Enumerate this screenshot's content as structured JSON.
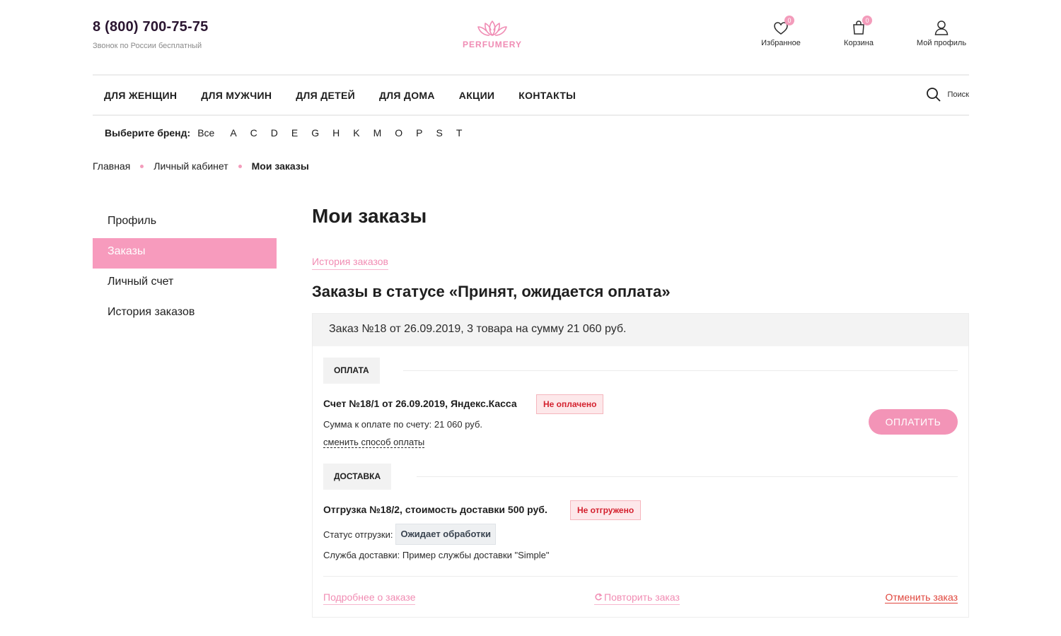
{
  "header": {
    "phone": "8 (800) 700-75-75",
    "phone_note": "Звонок по России бесплатный",
    "logo_text": "PERFUMERY",
    "favorites": {
      "label": "Избранное",
      "count": "0"
    },
    "cart": {
      "label": "Корзина",
      "count": "0"
    },
    "profile": {
      "label": "Мой профиль"
    }
  },
  "nav": {
    "items": [
      "ДЛЯ ЖЕНЩИН",
      "ДЛЯ МУЖЧИН",
      "ДЛЯ ДЕТЕЙ",
      "ДЛЯ ДОМА",
      "АКЦИИ",
      "КОНТАКТЫ"
    ],
    "search_label": "Поиск"
  },
  "brands": {
    "label": "Выберите бренд:",
    "letters": [
      "Все",
      "A",
      "C",
      "D",
      "E",
      "G",
      "H",
      "K",
      "M",
      "O",
      "P",
      "S",
      "T"
    ]
  },
  "breadcrumbs": [
    "Главная",
    "Личный кабинет",
    "Мои заказы"
  ],
  "sidebar": {
    "items": [
      "Профиль",
      "Заказы",
      "Личный счет",
      "История заказов"
    ],
    "active_index": 1
  },
  "main": {
    "title": "Мои заказы",
    "history_link": "История заказов",
    "status_title": "Заказы в статусе «Принят, ожидается оплата»",
    "order": {
      "header": "Заказ №18 от 26.09.2019, 3 товара на сумму 21 060 руб.",
      "payment": {
        "tag": "ОПЛАТА",
        "invoice": "Счет №18/1 от 26.09.2019, Яндекс.Касса",
        "status": "Не оплачено",
        "amount": "Сумма к оплате по счету: 21 060 руб.",
        "change_method": "сменить способ оплаты",
        "pay_button": "ОПЛАТИТЬ"
      },
      "delivery": {
        "tag": "ДОСТАВКА",
        "shipment": "Отгрузка №18/2, стоимость доставки 500 руб.",
        "status": "Не отгружено",
        "shipment_status_label": "Статус отгрузки:",
        "shipment_status_value": "Ожидает обработки",
        "service": "Служба доставки: Пример службы доставки \"Simple\""
      },
      "actions": {
        "details": "Подробнее о заказе",
        "repeat": "Повторить заказ",
        "cancel": "Отменить заказ"
      }
    }
  },
  "colors": {
    "accent_pink": "#f394b7",
    "danger_red": "#d4212e",
    "text_dark": "#1e1e1e"
  }
}
